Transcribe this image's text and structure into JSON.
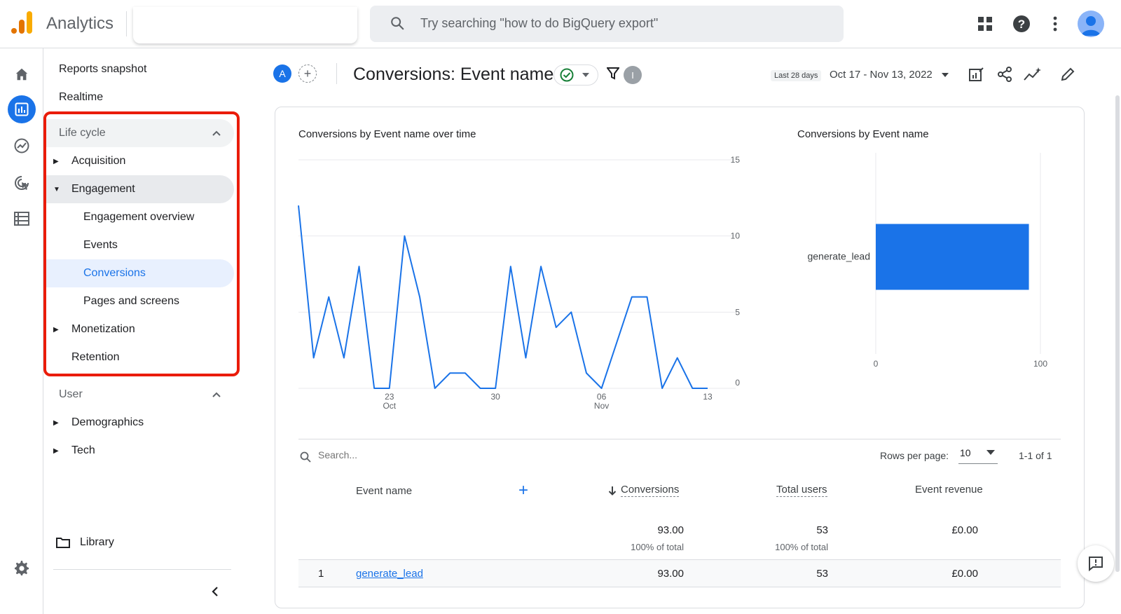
{
  "app": {
    "title": "Analytics",
    "search_placeholder": "Try searching \"how to do BigQuery export\""
  },
  "colors": {
    "accent": "#1a73e8",
    "highlight_red": "#ea1c0a",
    "selected_bg": "#e8f0fe",
    "logo_orange": "#f9ab00",
    "logo_dark_orange": "#e37400"
  },
  "rail_icons": [
    "home-icon",
    "reports-icon",
    "explore-icon",
    "advertising-icon",
    "configure-icon",
    "settings-icon"
  ],
  "nav": {
    "reports_snapshot": "Reports snapshot",
    "realtime": "Realtime",
    "lifecycle": {
      "label": "Life cycle",
      "acquisition": "Acquisition",
      "engagement": "Engagement",
      "engagement_overview": "Engagement overview",
      "events": "Events",
      "conversions": "Conversions",
      "pages_and_screens": "Pages and screens",
      "monetization": "Monetization",
      "retention": "Retention"
    },
    "user": {
      "label": "User",
      "demographics": "Demographics",
      "tech": "Tech"
    },
    "library": "Library"
  },
  "report": {
    "comparison_badge": "A",
    "title": "Conversions: Event name",
    "filter_count": "I",
    "date_tag": "Last 28 days",
    "date_range": "Oct 17 - Nov 13, 2022"
  },
  "line_chart_title": "Conversions by Event name over time",
  "bar_chart_title": "Conversions by Event name",
  "chart_data": [
    {
      "type": "line",
      "title": "Conversions by Event name over time",
      "x": [
        "Oct 17",
        "Oct 18",
        "Oct 19",
        "Oct 20",
        "Oct 21",
        "Oct 22",
        "Oct 23",
        "Oct 24",
        "Oct 25",
        "Oct 26",
        "Oct 27",
        "Oct 28",
        "Oct 29",
        "Oct 30",
        "Oct 31",
        "Nov 1",
        "Nov 2",
        "Nov 3",
        "Nov 4",
        "Nov 5",
        "Nov 6",
        "Nov 7",
        "Nov 8",
        "Nov 9",
        "Nov 10",
        "Nov 11",
        "Nov 12",
        "Nov 13"
      ],
      "series": [
        {
          "values": [
            12,
            2,
            6,
            2,
            8,
            0,
            0,
            10,
            6,
            0,
            1,
            1,
            0,
            0,
            8,
            2,
            8,
            4,
            5,
            1,
            0,
            3,
            6,
            6,
            0,
            2,
            0,
            0
          ]
        }
      ],
      "x_ticks": [
        {
          "day": "23",
          "month": "Oct",
          "index": 6
        },
        {
          "day": "30",
          "month": "",
          "index": 13
        },
        {
          "day": "06",
          "month": "Nov",
          "index": 20
        },
        {
          "day": "13",
          "month": "",
          "index": 27
        }
      ],
      "y_ticks": [
        "0",
        "5",
        "10",
        "15"
      ],
      "ylim": [
        0,
        15
      ],
      "grid": true,
      "color": "#1a73e8"
    },
    {
      "type": "bar",
      "orientation": "horizontal",
      "title": "Conversions by Event name",
      "categories": [
        "generate_lead"
      ],
      "values": [
        93
      ],
      "x_ticks": [
        "0",
        "100"
      ],
      "xlim": [
        0,
        100
      ],
      "color": "#1a73e8"
    }
  ],
  "table": {
    "search_placeholder": "Search...",
    "rows_per_page_label": "Rows per page:",
    "rows_per_page_value": "10",
    "pagination": "1-1 of 1",
    "headers": {
      "event_name": "Event name",
      "conversions": "Conversions",
      "total_users": "Total users",
      "event_revenue": "Event revenue"
    },
    "totals": {
      "conversions": "93.00",
      "conversions_pct": "100% of total",
      "total_users": "53",
      "total_users_pct": "100% of total",
      "event_revenue": "£0.00"
    },
    "rows": [
      {
        "index": "1",
        "event_name": "generate_lead",
        "conversions": "93.00",
        "total_users": "53",
        "event_revenue": "£0.00"
      }
    ]
  }
}
